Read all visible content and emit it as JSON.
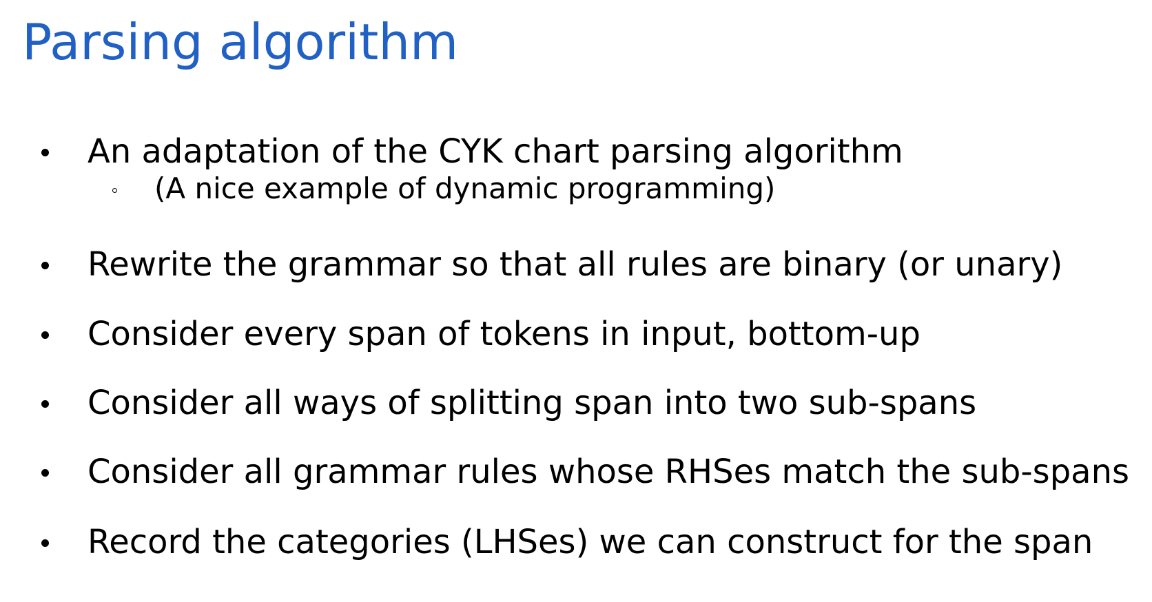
{
  "slide": {
    "title": "Parsing algorithm",
    "title_color": "#2160c4",
    "bullets": [
      {
        "text": "An adaptation of the CYK chart parsing algorithm",
        "sub_bullets": [
          {
            "text": "(A nice example of dynamic programming)"
          }
        ]
      },
      {
        "text": "Rewrite the grammar so that all rules are binary (or unary)"
      },
      {
        "text": "Consider every span of tokens in input, bottom-up"
      },
      {
        "text": "Consider all ways of splitting span into two sub-spans"
      },
      {
        "text": "Consider all grammar rules whose RHSes match the sub-spans"
      },
      {
        "text": "Record the categories (LHSes) we can construct for the span"
      }
    ]
  }
}
